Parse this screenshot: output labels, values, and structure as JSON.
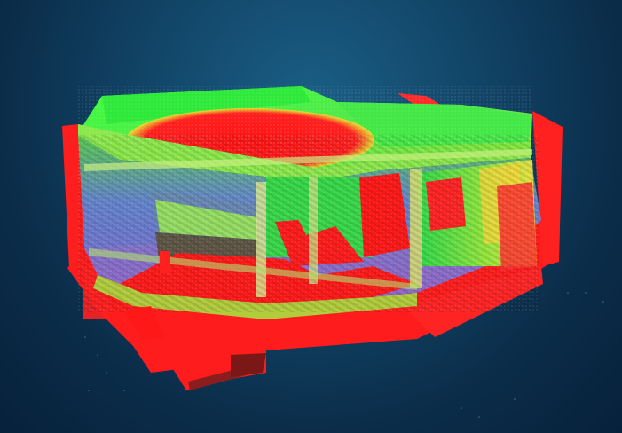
{
  "image": {
    "palette": {
      "background_top": "#1b5f86",
      "background_bottom": "#07213a",
      "high": "#ff1a1a",
      "mid": "#33ff33",
      "low": "#4d55ff",
      "transition": "#e6e62e"
    }
  }
}
